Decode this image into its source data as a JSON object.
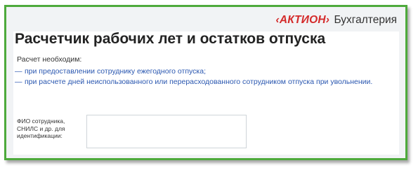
{
  "brand": {
    "logo": "‹АКТИОН›",
    "product": "Бухгалтерия"
  },
  "page": {
    "title": "Расчетчик рабочих лет и остатков отпуска"
  },
  "intro": {
    "label": "Расчет необходим:",
    "dash": "—",
    "items": [
      "при предоставлении сотруднику ежегодного отпуска;",
      "при расчете дней неиспользованного или перерасходованного сотрудником отпуска при увольнении."
    ]
  },
  "form": {
    "employee_label": "ФИО сотрудника, СНИЛС и др. для идентификации:",
    "employee_value": ""
  },
  "colors": {
    "frame_border": "#4eaa3c",
    "brand_red": "#d42a2a",
    "link_blue": "#2a57b0",
    "panel_bg": "#f1f3f5"
  }
}
